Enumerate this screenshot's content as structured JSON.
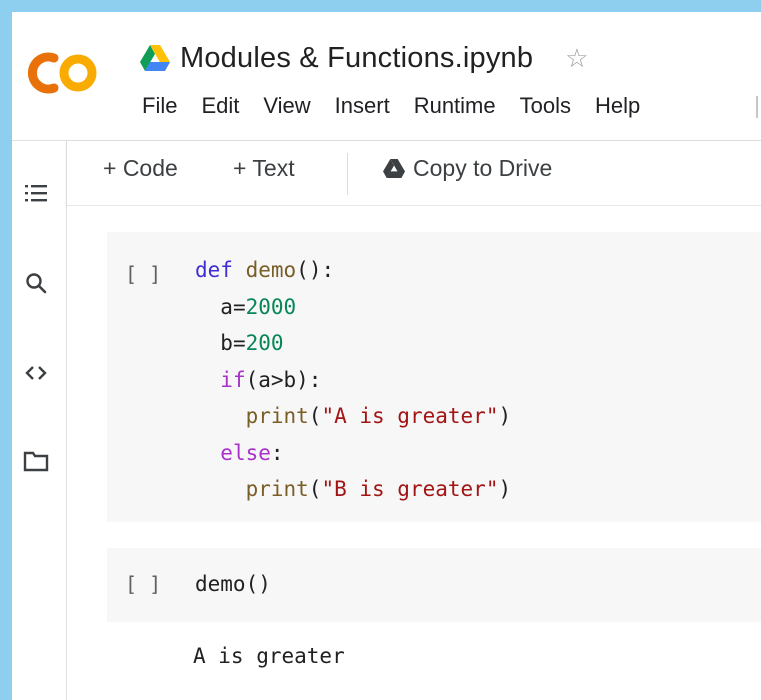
{
  "window": {
    "title": "Modules & Functions.ipynb",
    "logo_text": "CO",
    "colors": {
      "logo_orange": "#f9ab00",
      "logo_dark_orange": "#e8710a",
      "background_frame": "#8ecff0"
    }
  },
  "menu": [
    "File",
    "Edit",
    "View",
    "Insert",
    "Runtime",
    "Tools",
    "Help"
  ],
  "toolbar": {
    "code_label": "+ Code",
    "text_label": "+ Text",
    "copy_label": "Copy to Drive"
  },
  "rail": {
    "icons": [
      "toc-icon",
      "search-icon",
      "code-snippets-icon",
      "folder-icon"
    ]
  },
  "cells": [
    {
      "run_label": "[ ]",
      "lines": [
        "def demo():",
        "  a=2000",
        "  b=200",
        "  if(a>b):",
        "    print(\"A is greater\")",
        "  else:",
        "    print(\"B is greater\")"
      ]
    },
    {
      "run_label": "[ ]",
      "lines": [
        "demo()"
      ],
      "output": "A is greater"
    }
  ],
  "tokens": {
    "def": "def",
    "demo_name": "demo",
    "demo_sig": "():",
    "a_assign": "a=",
    "a_val": "2000",
    "b_assign": "b=",
    "b_val": "200",
    "if_kw": "if",
    "if_cond": "(a>b):",
    "print": "print",
    "open_paren": "(",
    "str_a": "\"A is greater\"",
    "close_paren": ")",
    "else_kw": "else",
    "colon": ":",
    "str_b": "\"B is greater\"",
    "call": "demo()"
  }
}
